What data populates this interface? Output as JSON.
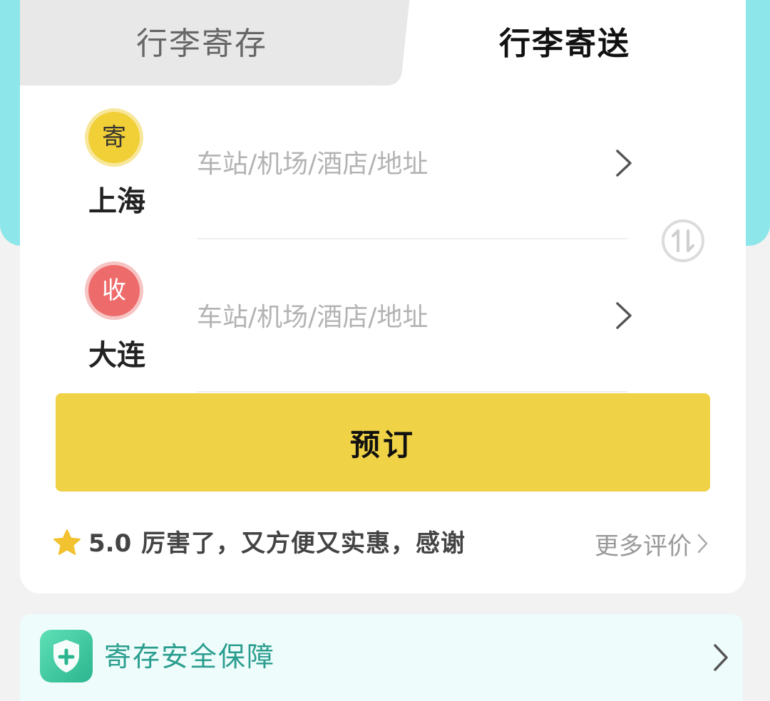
{
  "tabs": {
    "storage": "行李寄存",
    "delivery": "行李寄送"
  },
  "sender": {
    "badge": "寄",
    "city": "上海",
    "placeholder": "车站/机场/酒店/地址"
  },
  "receiver": {
    "badge": "收",
    "city": "大连",
    "placeholder": "车站/机场/酒店/地址"
  },
  "book_button": "预订",
  "review": {
    "score": "5.0",
    "text": "厉害了，又方便又实惠，感谢",
    "more": "更多评价"
  },
  "safety": {
    "label": "寄存安全保障"
  },
  "colors": {
    "accent_yellow": "#f0d246",
    "teal_header": "#8ce6ea",
    "receive_red": "#ee6b6b",
    "safety_green": "#2bb58f"
  },
  "icons": {
    "swap": "swap-icon",
    "chevron": "chevron-right-icon",
    "star": "star-icon",
    "shield": "shield-plus-icon"
  }
}
